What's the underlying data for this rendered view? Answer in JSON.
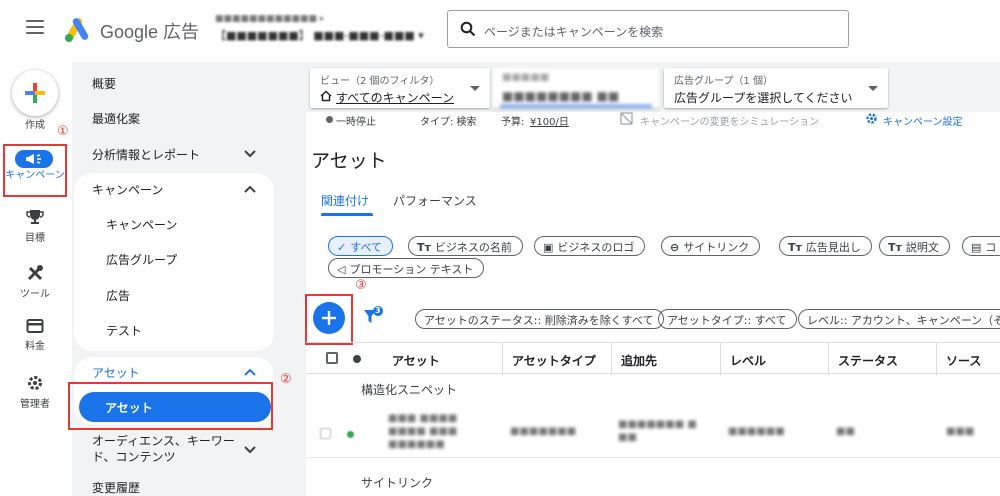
{
  "header": {
    "brand": "Google 広告",
    "search_placeholder": "ページまたはキャンペーンを検索"
  },
  "rail": {
    "create": "作成",
    "campaigns": "キャンペーン",
    "goals": "目標",
    "tools": "ツール",
    "billing": "料金",
    "admin": "管理者"
  },
  "annotations": {
    "one": "①",
    "two": "②",
    "three": "③"
  },
  "nav": {
    "overview": "概要",
    "recommendations": "最適化案",
    "insights": "分析情報とレポート",
    "campaigns_group": "キャンペーン",
    "campaigns": "キャンペーン",
    "adgroups": "広告グループ",
    "ads": "広告",
    "test": "テスト",
    "assets_group": "アセット",
    "assets": "アセット",
    "audiences": "オーディエンス、キーワー",
    "audiences_2": "ド、コンテンツ",
    "history": "変更履歴"
  },
  "filters": {
    "view_label": "ビュー（2 個のフィルタ）",
    "view_value": "すべてのキャンペーン",
    "adgroup_label": "広告グループ（1 個）",
    "adgroup_value": "広告グループを選択してください"
  },
  "status": {
    "paused": "一時停止",
    "type": "タイプ: 検索",
    "budget_label": "予算:",
    "budget_value": "¥100/日",
    "simulate": "キャンペーンの変更をシミュレーション",
    "settings": "キャンペーン設定"
  },
  "page": {
    "title": "アセット"
  },
  "tabs": {
    "association": "関連付け",
    "performance": "パフォーマンス"
  },
  "asset_chips": [
    "すべて",
    "ビジネスの名前",
    "ビジネスのロゴ",
    "サイトリンク",
    "広告見出し",
    "説明文",
    "コ",
    "プロモーション テキスト"
  ],
  "filter_count": "3",
  "filter_chips": [
    "アセットのステータス:: 削除済みを除くすべて",
    "アセットタイプ:: すべて",
    "レベル:: アカウント、キャンペーン（その"
  ],
  "table": {
    "columns": [
      "アセット",
      "アセットタイプ",
      "追加先",
      "レベル",
      "ステータス",
      "ソース"
    ],
    "section1": "構造化スニペット",
    "section2": "サイトリンク"
  }
}
